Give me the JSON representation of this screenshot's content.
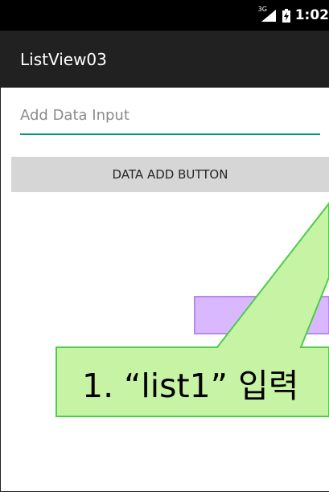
{
  "status_bar": {
    "network": "3G",
    "time": "1:02"
  },
  "app_bar": {
    "title": "ListView03"
  },
  "input": {
    "placeholder": "Add Data Input",
    "value": ""
  },
  "button": {
    "label": "DATA ADD BUTTON"
  },
  "annotation": {
    "text": "1. “list1” 입력"
  },
  "colors": {
    "status_bar": "#000000",
    "app_bar": "#212121",
    "accent": "#009688",
    "button": "#d6d6d6",
    "callout_fill": "#c6f4a4",
    "callout_border": "#4ecb4e",
    "highlight_fill": "#dab8ff",
    "highlight_border": "#b68ae8"
  },
  "icons": {
    "signal": "signal-icon",
    "battery": "battery-charging-icon"
  }
}
